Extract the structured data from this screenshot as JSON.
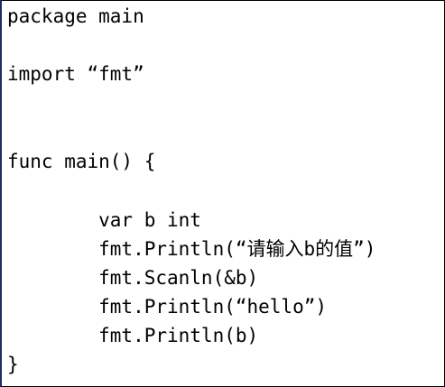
{
  "editor": {
    "lines": [
      "package main",
      "import “fmt”",
      "func main() {",
      "        var b int",
      "        fmt.Println(“请输入b的值”)",
      "        fmt.Scanln(&b)",
      "        fmt.Println(“hello”)",
      "        fmt.Println(b)",
      "}"
    ]
  }
}
